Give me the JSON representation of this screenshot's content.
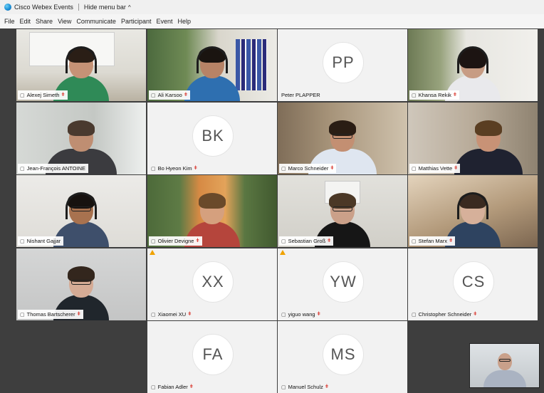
{
  "titlebar": {
    "app_title": "Cisco Webex Events",
    "hide_menu_bar": "Hide menu bar",
    "caret": "^"
  },
  "menubar": {
    "items": [
      "File",
      "Edit",
      "Share",
      "View",
      "Communicate",
      "Participant",
      "Event",
      "Help"
    ]
  },
  "participants": [
    {
      "name": "Alexej Simeth",
      "mic_muted": true
    },
    {
      "name": "Ali Karsoo",
      "mic_muted": true
    },
    {
      "name": "Peter PLAPPER",
      "initials": "PP",
      "mic_muted": false
    },
    {
      "name": "Khansa Rekik",
      "mic_muted": true
    },
    {
      "name": "Jean-François ANTOINE",
      "mic_muted": false
    },
    {
      "name": "Bo Hyeon Kim",
      "initials": "BK",
      "mic_muted": true
    },
    {
      "name": "Marco Schneider",
      "mic_muted": true
    },
    {
      "name": "Matthias Vette",
      "mic_muted": true
    },
    {
      "name": "Nishant Gajjar",
      "mic_muted": false
    },
    {
      "name": "Olivier Devigne",
      "mic_muted": true
    },
    {
      "name": "Sebastian Groß",
      "mic_muted": true
    },
    {
      "name": "Stefan Marx",
      "mic_muted": true
    },
    {
      "name": "Thomas Bartscherer",
      "mic_muted": true
    },
    {
      "name": "Xiaomei XU",
      "initials": "XX",
      "mic_muted": true
    },
    {
      "name": "yiguo wang",
      "initials": "YW",
      "mic_muted": true
    },
    {
      "name": "Christopher Schneider",
      "initials": "CS",
      "mic_muted": true
    },
    {
      "name": "Fabian Adler",
      "initials": "FA",
      "mic_muted": true
    },
    {
      "name": "Manuel Schulz",
      "initials": "MS",
      "mic_muted": true
    }
  ],
  "icons": {
    "camera": "▢",
    "mic_off": "ǂ"
  },
  "colors": {
    "stage_background": "#3e3e3e",
    "avatar_tile": "#f2f2f2",
    "mic_muted_red": "#d9342b",
    "warning_yellow": "#f0a200"
  }
}
